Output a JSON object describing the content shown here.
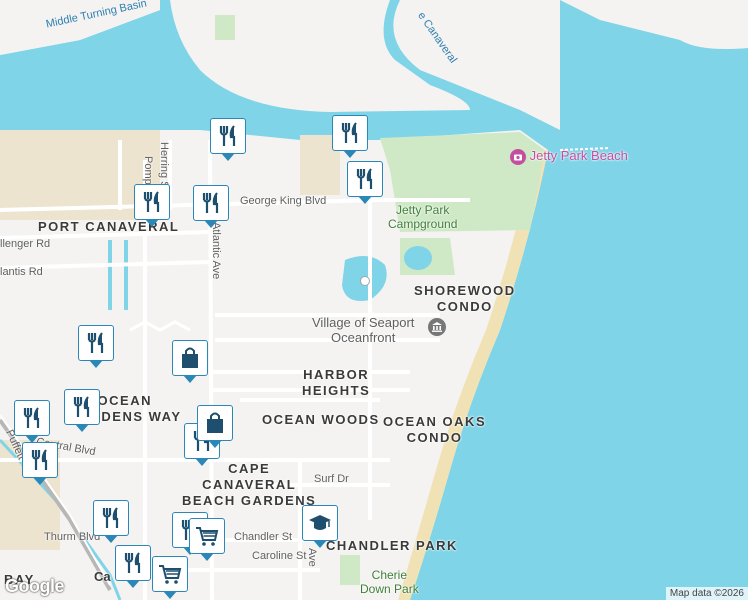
{
  "map": {
    "area_labels": {
      "port_canaveral": "PORT CANAVERAL",
      "shorewood": "SHOREWOOD\nCONDO",
      "harbor_heights": "HARBOR\nHEIGHTS",
      "ocean_gardens_way": "OCEAN\nGARDENS WAY",
      "ocean_woods": "OCEAN WOODS",
      "ocean_oaks": "OCEAN OAKS\nCONDO",
      "cape_canaveral_beach_gardens": "CAPE\nCANAVERAL\nBEACH GARDENS",
      "chandler_park": "CHANDLER PARK",
      "bay": "BAY",
      "cape_partial": "Ca"
    },
    "street_labels": {
      "george_king_blvd": "George King Blvd",
      "challenger_rd": "llenger Rd",
      "atlantis_rd": "lantis Rd",
      "herring_st": "Herring St",
      "pompano": "Pomp",
      "atlantic_ave": "Atlantic Ave",
      "central_blvd": "Central Blvd",
      "surf_dr": "Surf Dr",
      "chandler_st": "Chandler St",
      "caroline_st": "Caroline St",
      "thurm_blvd": "Thurm Blvd",
      "ridgewood_ave": "Ave",
      "astronaut_blvd": "Puffett W"
    },
    "water_labels": {
      "middle_turning_basin": "Middle Turning Basin",
      "canaveral": "e Canaveral"
    },
    "poi_labels": {
      "jetty_park_beach": "Jetty Park Beach",
      "jetty_park_campground": "Jetty Park\nCampground",
      "village_of_seaport": "Village of Seaport\nOceanfront",
      "cherie_down_park": "Cherie\nDown Park"
    },
    "colors": {
      "water": "#7fd4e8",
      "land": "#f4f3f1",
      "park": "#cfe9c6",
      "beach": "#f1e2b5",
      "pin_border": "#2a87b8",
      "pin_icon": "#1f4f6e"
    },
    "pins": {
      "restaurant_1": "restaurant-icon",
      "restaurant_2": "restaurant-icon",
      "restaurant_3": "restaurant-icon",
      "restaurant_4": "restaurant-icon",
      "restaurant_5": "restaurant-icon",
      "restaurant_6": "restaurant-icon",
      "restaurant_7": "restaurant-icon",
      "restaurant_8": "restaurant-icon",
      "restaurant_9": "restaurant-icon",
      "restaurant_10": "restaurant-icon",
      "restaurant_11": "restaurant-icon",
      "restaurant_12": "restaurant-icon",
      "restaurant_13": "restaurant-icon",
      "shopping_bag_1": "shopping-bag-icon",
      "shopping_bag_2": "shopping-bag-icon",
      "grocery_1": "shopping-cart-icon",
      "grocery_2": "shopping-cart-icon",
      "school_1": "graduation-cap-icon"
    }
  },
  "branding": {
    "logo": "Google",
    "credit": "Map data ©2026"
  }
}
